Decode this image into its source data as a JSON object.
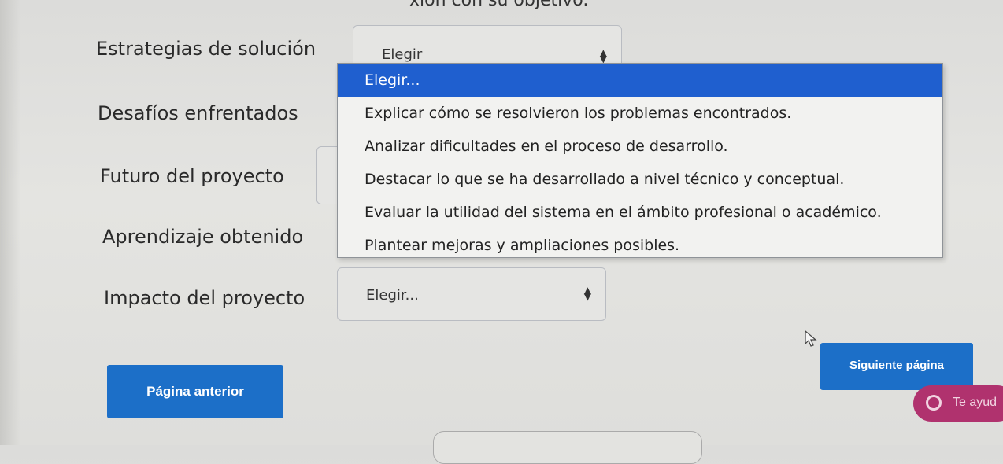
{
  "top_text": "xión con su objetivo.",
  "fields": [
    {
      "label": "Estrategias de solución",
      "value": "Elegir"
    },
    {
      "label": "Desafíos enfrentados"
    },
    {
      "label": "Futuro del proyecto"
    },
    {
      "label": "Aprendizaje obtenido"
    },
    {
      "label": "Impacto del proyecto",
      "value": "Elegir..."
    }
  ],
  "dropdown": {
    "options": [
      "Elegir...",
      "Explicar cómo se resolvieron los problemas encontrados.",
      "Analizar dificultades en el proceso de desarrollo.",
      "Destacar lo que se ha desarrollado a nivel técnico y conceptual.",
      "Evaluar la utilidad del sistema en el ámbito profesional o académico.",
      "Plantear mejoras y ampliaciones posibles."
    ],
    "selected_index": 0
  },
  "buttons": {
    "prev": "Página anterior",
    "next": "Siguiente página"
  },
  "help": {
    "label": "Te ayud",
    "icon": "chat-bubble-icon"
  },
  "cursor_icon": "mouse-pointer-icon",
  "colors": {
    "accent": "#1f5fcf",
    "button": "#1c6fc8",
    "help": "#b0326e"
  }
}
